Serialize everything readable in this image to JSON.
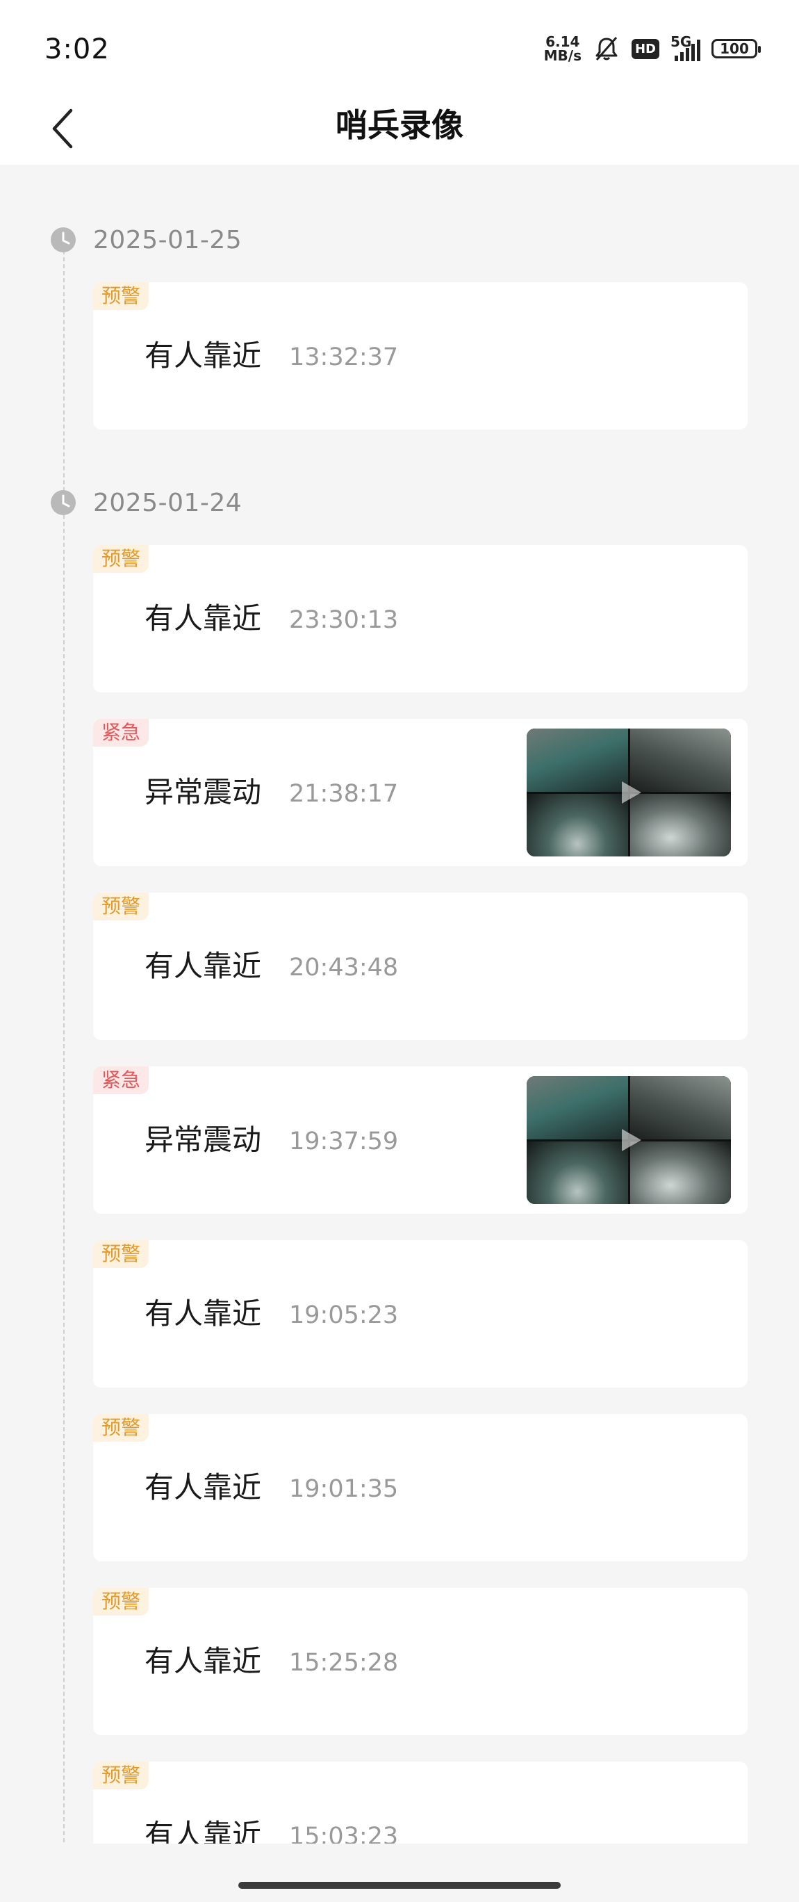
{
  "status_bar": {
    "time": "3:02",
    "speed_value": "6.14",
    "speed_unit": "MB/s",
    "hd_label": "HD",
    "network_label": "5G",
    "battery": "100",
    "icons": [
      "bell-muted-icon",
      "hd-icon",
      "signal-icon",
      "battery-icon"
    ]
  },
  "header": {
    "title": "哨兵录像",
    "back_icon": "chevron-left-icon"
  },
  "colors": {
    "warn_text": "#e39a2b",
    "warn_bg": "#fdf1df",
    "urgent_text": "#e2585a",
    "urgent_bg": "#fde8e8"
  },
  "groups": [
    {
      "date": "2025-01-25",
      "events": [
        {
          "badge": "预警",
          "level": "warn",
          "title": "有人靠近",
          "time": "13:32:37",
          "has_video": false
        }
      ]
    },
    {
      "date": "2025-01-24",
      "events": [
        {
          "badge": "预警",
          "level": "warn",
          "title": "有人靠近",
          "time": "23:30:13",
          "has_video": false
        },
        {
          "badge": "紧急",
          "level": "urgent",
          "title": "异常震动",
          "time": "21:38:17",
          "has_video": true
        },
        {
          "badge": "预警",
          "level": "warn",
          "title": "有人靠近",
          "time": "20:43:48",
          "has_video": false
        },
        {
          "badge": "紧急",
          "level": "urgent",
          "title": "异常震动",
          "time": "19:37:59",
          "has_video": true
        },
        {
          "badge": "预警",
          "level": "warn",
          "title": "有人靠近",
          "time": "19:05:23",
          "has_video": false
        },
        {
          "badge": "预警",
          "level": "warn",
          "title": "有人靠近",
          "time": "19:01:35",
          "has_video": false
        },
        {
          "badge": "预警",
          "level": "warn",
          "title": "有人靠近",
          "time": "15:25:28",
          "has_video": false
        },
        {
          "badge": "预警",
          "level": "warn",
          "title": "有人靠近",
          "time": "15:03:23",
          "has_video": false
        }
      ]
    }
  ]
}
